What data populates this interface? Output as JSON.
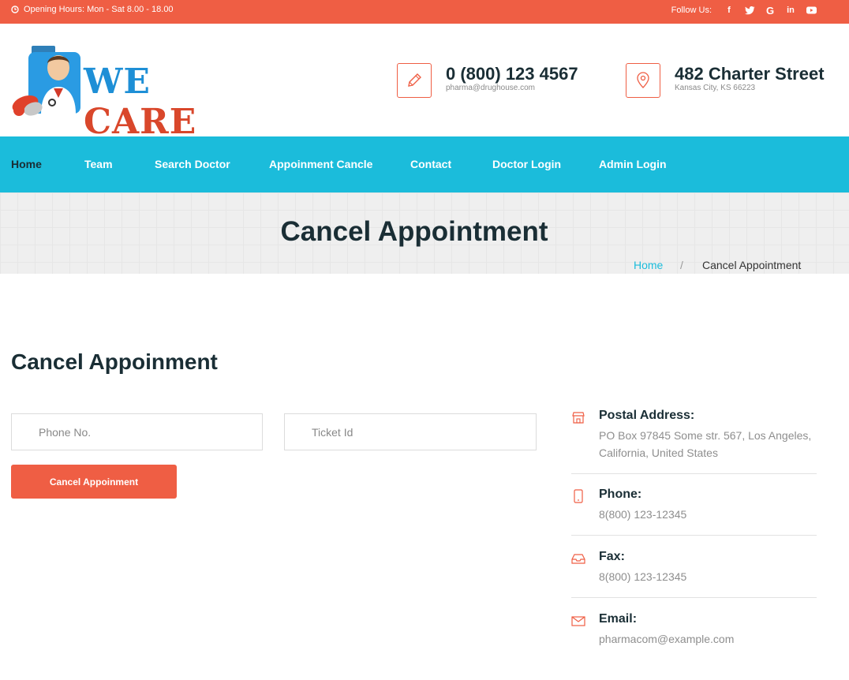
{
  "topbar": {
    "hours": "Opening Hours: Mon - Sat 8.00 - 18.00",
    "follow_label": "Follow Us:",
    "social_icons": [
      "facebook-icon",
      "twitter-icon",
      "google-icon",
      "linkedin-icon",
      "youtube-icon"
    ]
  },
  "logo": {
    "word1": "WE",
    "word2": "CARE"
  },
  "header": {
    "phone": {
      "number": "0 (800) 123 4567",
      "email": "pharma@drughouse.com"
    },
    "address": {
      "street": "482 Charter Street",
      "city": "Kansas City, KS 66223"
    }
  },
  "nav": {
    "items": [
      {
        "label": "Home",
        "active": true
      },
      {
        "label": "Team"
      },
      {
        "label": "Search Doctor"
      },
      {
        "label": "Appoinment Cancle"
      },
      {
        "label": "Contact"
      },
      {
        "label": "Doctor Login"
      },
      {
        "label": "Admin Login"
      }
    ]
  },
  "banner": {
    "title": "Cancel Appointment",
    "breadcrumb": {
      "home": "Home",
      "separator": "/",
      "current": "Cancel Appointment"
    }
  },
  "form": {
    "title": "Cancel Appoinment",
    "phone_placeholder": "Phone No.",
    "ticket_placeholder": "Ticket Id",
    "submit_label": "Cancel Appoinment"
  },
  "info": {
    "postal": {
      "title": "Postal Address:",
      "value": "PO Box 97845 Some str. 567, Los Angeles, California, United States"
    },
    "phone": {
      "title": "Phone:",
      "value": "8(800) 123-12345"
    },
    "fax": {
      "title": "Fax:",
      "value": "8(800) 123-12345"
    },
    "email": {
      "title": "Email:",
      "value": "pharmacom@example.com"
    }
  },
  "colors": {
    "accent": "#ef5e44",
    "nav": "#1bbcdb",
    "heading": "#1a2e35"
  }
}
